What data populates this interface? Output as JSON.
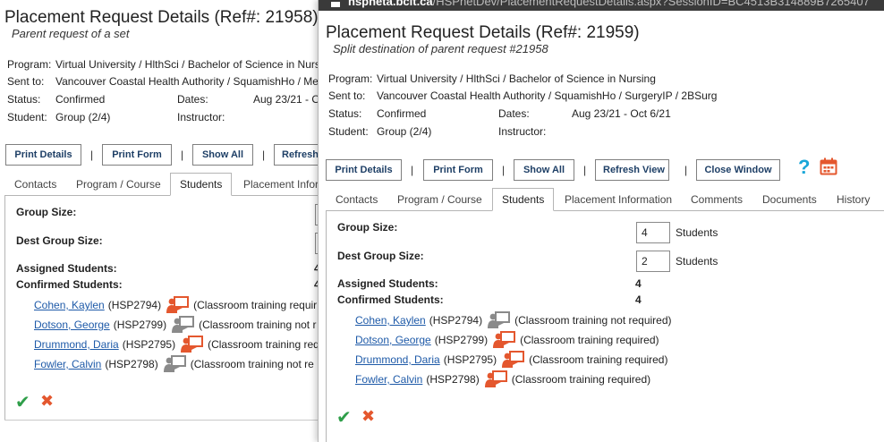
{
  "browser": {
    "host": "hspneta.bcit.ca",
    "path": "/HSPnetDev/PlacementRequestDetails.aspx?SessionID=BC4513B314889B7265407"
  },
  "labels": {
    "program": "Program:",
    "sent_to": "Sent to:",
    "status": "Status:",
    "student": "Student:",
    "dates": "Dates:",
    "instructor": "Instructor:",
    "group_size": "Group Size:",
    "dest_group_size": "Dest Group Size:",
    "assigned_students": "Assigned Students:",
    "confirmed_students": "Confirmed Students:",
    "students_unit": "Students",
    "tab_separator": "|",
    "icon_ok": "✔",
    "icon_cancel": "✖",
    "icon_help": "?"
  },
  "back": {
    "title": "Placement Request Details (Ref#: 21958)",
    "subtitle": "Parent request of a set",
    "program": "Virtual University / HlthSci / Bachelor of Science in Nursing",
    "sent_to": "Vancouver Coastal Health Authority / SquamishHo / Me",
    "status": "Confirmed",
    "dates": "Aug 23/21 - O",
    "student": "Group (2/4)",
    "instructor": "",
    "buttons": [
      "Print Details",
      "Print Form",
      "Show All",
      "Refresh"
    ],
    "tabs": [
      "Contacts",
      "Program / Course",
      "Students",
      "Placement Infor"
    ],
    "active_tab": "Students",
    "assigned": "4",
    "confirmed": "4",
    "students": [
      {
        "name": "Cohen, Kaylen",
        "id": "(HSP2794)",
        "icon": "person-training-required-icon",
        "note": "(Classroom training requir"
      },
      {
        "name": "Dotson, George",
        "id": "(HSP2799)",
        "icon": "person-training-not-required-icon",
        "note": "(Classroom training not r"
      },
      {
        "name": "Drummond, Daria",
        "id": "(HSP2795)",
        "icon": "person-training-required-icon",
        "note": "(Classroom training req"
      },
      {
        "name": "Fowler, Calvin",
        "id": "(HSP2798)",
        "icon": "person-training-not-required-icon",
        "note": "(Classroom training not re"
      }
    ]
  },
  "front": {
    "title": "Placement Request Details (Ref#: 21959)",
    "subtitle": "Split destination of parent request #21958",
    "program": "Virtual University / HlthSci / Bachelor of Science in Nursing",
    "sent_to": "Vancouver Coastal Health Authority / SquamishHo / SurgeryIP / 2BSurg",
    "status": "Confirmed",
    "dates": "Aug 23/21 - Oct 6/21",
    "student": "Group (2/4)",
    "instructor": "",
    "buttons": [
      "Print Details",
      "Print Form",
      "Show All",
      "Refresh View",
      "Close Window"
    ],
    "tabs": [
      "Contacts",
      "Program / Course",
      "Students",
      "Placement Information",
      "Comments",
      "Documents",
      "History"
    ],
    "active_tab": "Students",
    "group_size": "4",
    "dest_group_size": "2",
    "assigned": "4",
    "confirmed": "4",
    "students": [
      {
        "name": "Cohen, Kaylen",
        "id": "(HSP2794)",
        "icon": "person-training-not-required-icon",
        "note": "(Classroom training not required)"
      },
      {
        "name": "Dotson, George",
        "id": "(HSP2799)",
        "icon": "person-training-required-icon",
        "note": "(Classroom training required)"
      },
      {
        "name": "Drummond, Daria",
        "id": "(HSP2795)",
        "icon": "person-training-required-icon",
        "note": "(Classroom training required)"
      },
      {
        "name": "Fowler, Calvin",
        "id": "(HSP2798)",
        "icon": "person-training-required-icon",
        "note": "(Classroom training required)"
      }
    ]
  },
  "colors": {
    "link": "#1e5aa8",
    "button_text": "#1e3f66",
    "training_required": "#e4572e",
    "training_not_required": "#8a8a8a",
    "ok": "#2e9e49",
    "help": "#19a6d8"
  }
}
